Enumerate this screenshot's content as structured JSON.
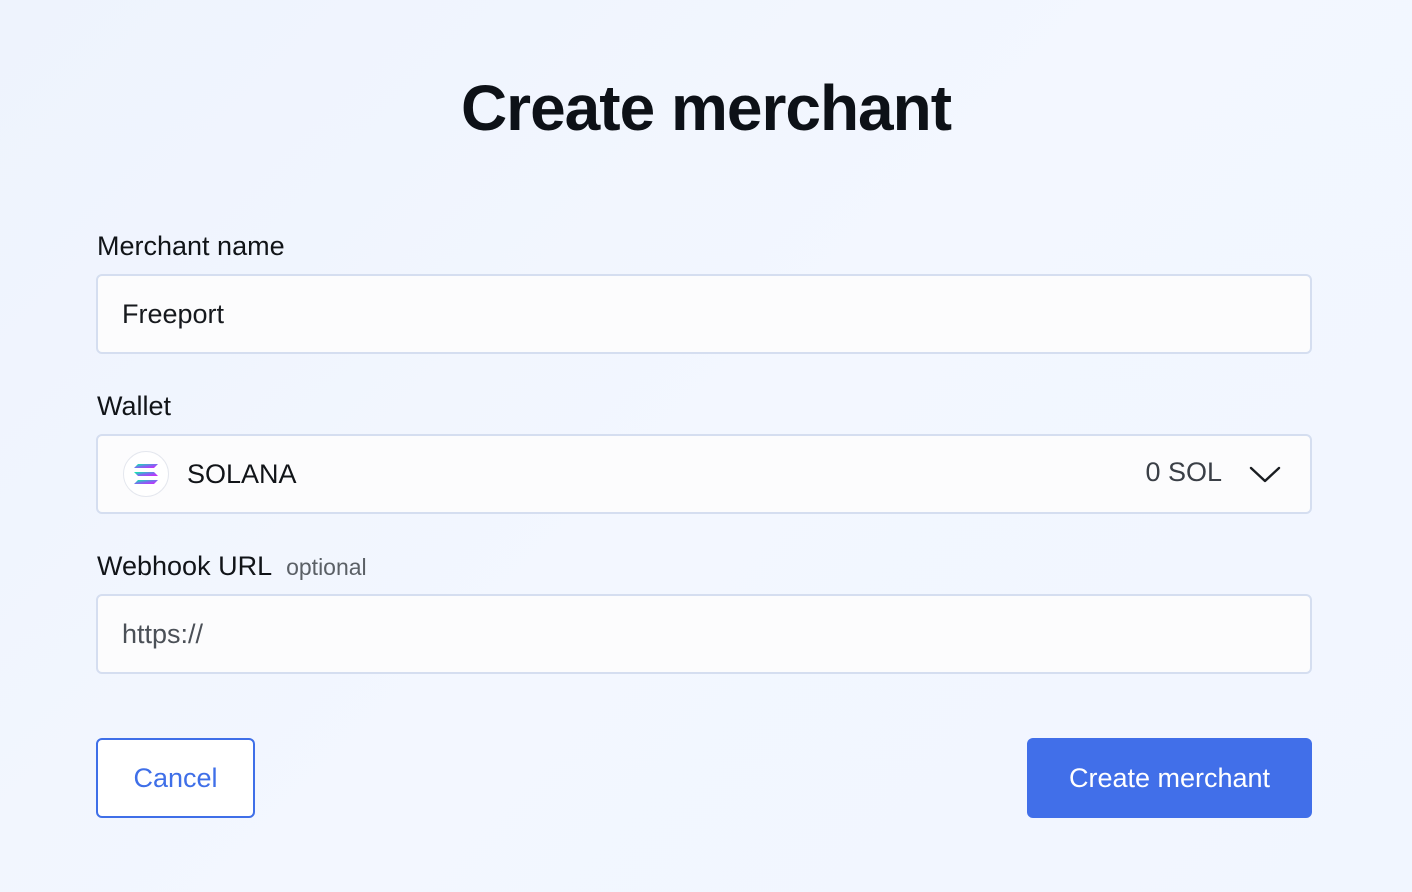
{
  "page": {
    "title": "Create merchant"
  },
  "form": {
    "merchant_name": {
      "label": "Merchant name",
      "value": "Freeport"
    },
    "wallet": {
      "label": "Wallet",
      "selected_name": "SOLANA",
      "balance": "0 SOL",
      "icon": "solana-icon"
    },
    "webhook": {
      "label": "Webhook URL",
      "optional_label": "optional",
      "value": "",
      "placeholder": "https://"
    }
  },
  "actions": {
    "cancel_label": "Cancel",
    "submit_label": "Create merchant"
  },
  "colors": {
    "accent": "#416fe9",
    "background": "#f1f6ff",
    "border": "#d5def0"
  }
}
